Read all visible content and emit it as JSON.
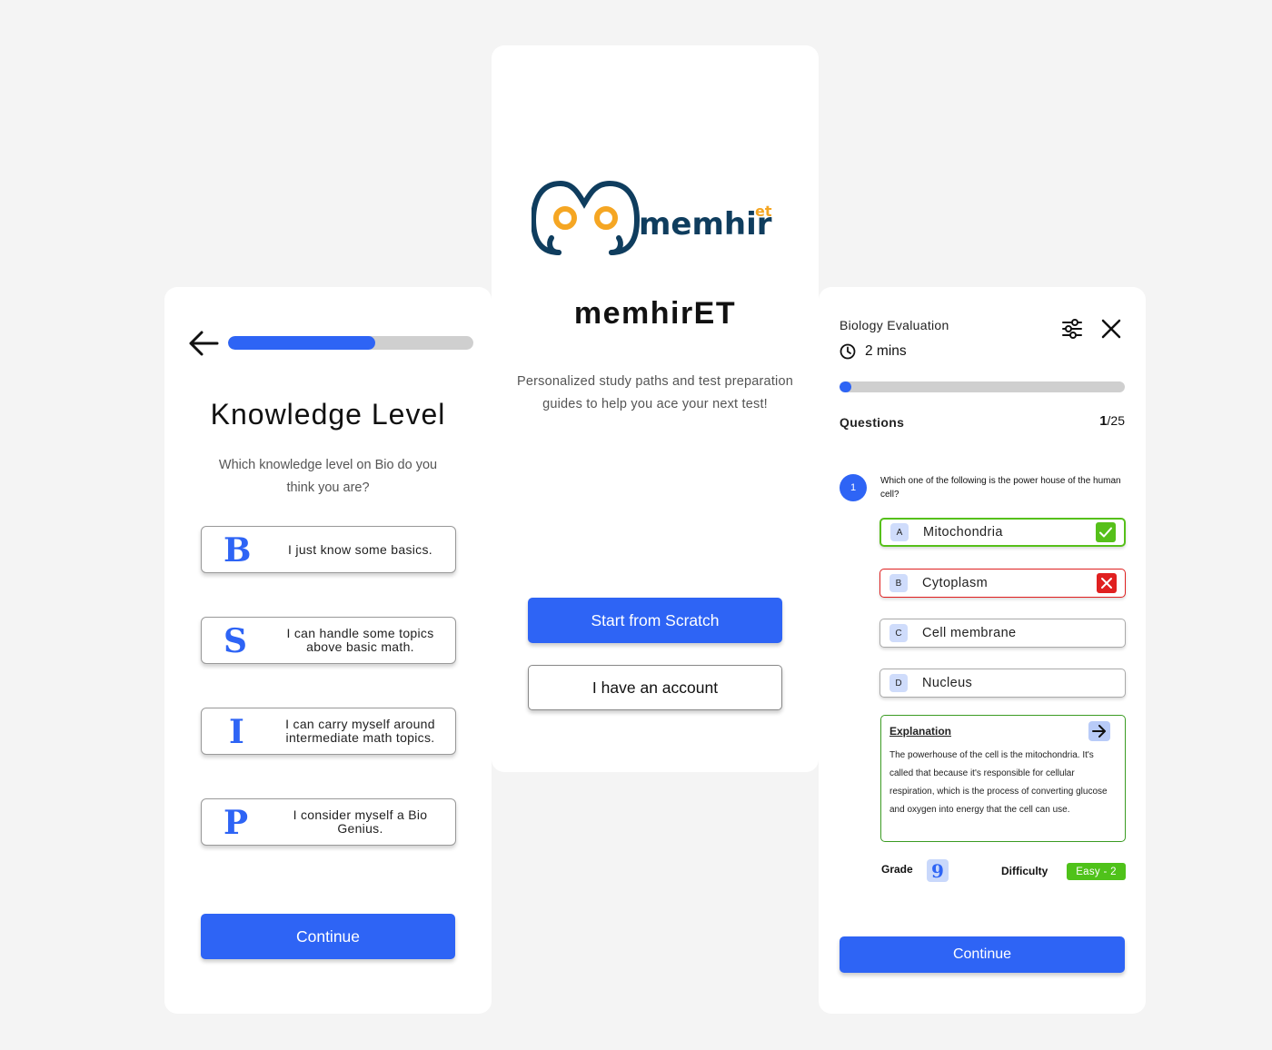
{
  "knowledge_screen": {
    "back_icon": "arrow-left-icon",
    "progress_percent": 60,
    "title": "Knowledge Level",
    "subtitle": "Which knowledge level on Bio do you think you are?",
    "levels": [
      {
        "letter": "B",
        "text": "I just know some basics."
      },
      {
        "letter": "S",
        "text": "I can handle some topics above basic math."
      },
      {
        "letter": "I",
        "text": "I can carry myself around intermediate math topics."
      },
      {
        "letter": "P",
        "text": "I consider myself a Bio Genius."
      }
    ],
    "continue_label": "Continue",
    "accent_color": "#2e64f5"
  },
  "welcome_screen": {
    "logo_text": "memhir",
    "logo_superscript": "et",
    "app_name": "memhirET",
    "tagline": "Personalized study paths and test preparation guides to help you ace your next test!",
    "start_label": "Start from Scratch",
    "account_label": "I have an account",
    "logo_colors": {
      "primary": "#0f3d5e",
      "accent": "#f5a623"
    }
  },
  "quiz_screen": {
    "title": "Biology Evaluation",
    "timer_icon": "clock-icon",
    "timer": "2 mins",
    "filter_icon": "sliders-icon",
    "close_icon": "close-icon",
    "progress_percent": 4,
    "questions_label": "Questions",
    "current": "1",
    "total": "/25",
    "question_number": "1",
    "question_text": "Which one of the following is the power house of the human cell?",
    "options": [
      {
        "letter": "A",
        "text": "Mitochondria",
        "state": "correct",
        "icon": "check-icon"
      },
      {
        "letter": "B",
        "text": "Cytoplasm",
        "state": "wrong",
        "icon": "x-icon"
      },
      {
        "letter": "C",
        "text": "Cell membrane",
        "state": "neutral"
      },
      {
        "letter": "D",
        "text": "Nucleus",
        "state": "neutral"
      }
    ],
    "explanation_title": "Explanation",
    "explanation_icon": "arrow-right-icon",
    "explanation_text": "The powerhouse of the cell is the mitochondria. It's called that because it's responsible for cellular respiration, which is the process of converting glucose and oxygen into energy that the cell can use.",
    "grade_label": "Grade",
    "grade_value": "9",
    "difficulty_label": "Difficulty",
    "difficulty_value": "Easy - 2",
    "continue_label": "Continue",
    "colors": {
      "correct": "#56c01a",
      "wrong": "#e02020"
    }
  }
}
